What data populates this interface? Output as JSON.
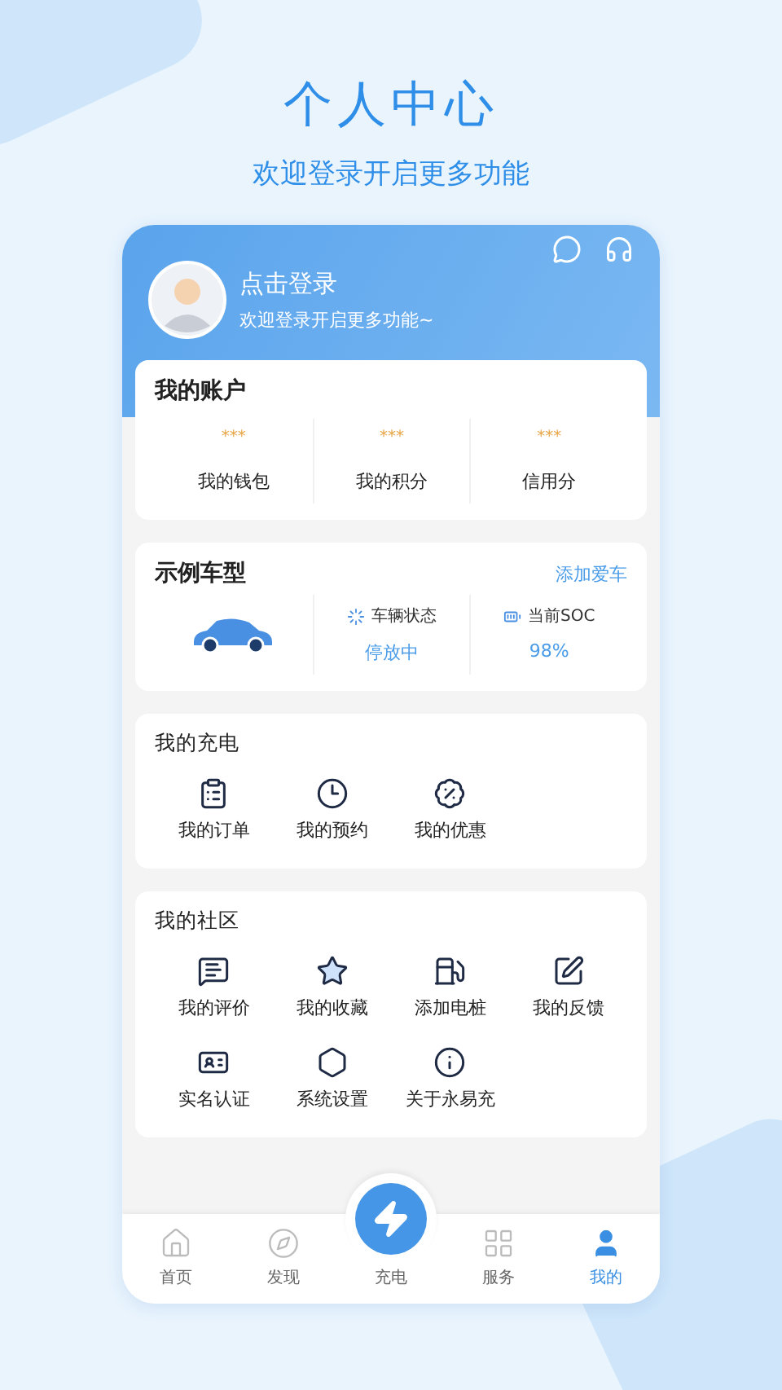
{
  "header": {
    "title": "个人中心",
    "subtitle": "欢迎登录开启更多功能"
  },
  "profile": {
    "name": "点击登录",
    "tagline": "欢迎登录开启更多功能~"
  },
  "account": {
    "title": "我的账户",
    "items": [
      {
        "value": "***",
        "label": "我的钱包"
      },
      {
        "value": "***",
        "label": "我的积分"
      },
      {
        "value": "***",
        "label": "信用分"
      }
    ]
  },
  "vehicle": {
    "title": "示例车型",
    "action": "添加爱车",
    "stats": [
      {
        "kind": "status",
        "label": "车辆状态",
        "value": "停放中"
      },
      {
        "kind": "soc",
        "label": "当前SOC",
        "value": "98%"
      }
    ]
  },
  "charging": {
    "title": "我的充电",
    "items": [
      {
        "kind": "order",
        "label": "我的订单"
      },
      {
        "kind": "booking",
        "label": "我的预约"
      },
      {
        "kind": "coupon",
        "label": "我的优惠"
      }
    ]
  },
  "community": {
    "title": "我的社区",
    "items": [
      {
        "kind": "review",
        "label": "我的评价"
      },
      {
        "kind": "favorite",
        "label": "我的收藏"
      },
      {
        "kind": "charger",
        "label": "添加电桩"
      },
      {
        "kind": "feedback",
        "label": "我的反馈"
      },
      {
        "kind": "verify",
        "label": "实名认证"
      },
      {
        "kind": "settings",
        "label": "系统设置"
      },
      {
        "kind": "about",
        "label": "关于永易充"
      }
    ]
  },
  "nav": [
    {
      "kind": "home",
      "label": "首页",
      "selected": false
    },
    {
      "kind": "discover",
      "label": "发现",
      "selected": false
    },
    {
      "kind": "charge",
      "label": "充电",
      "selected": false
    },
    {
      "kind": "service",
      "label": "服务",
      "selected": false
    },
    {
      "kind": "mine",
      "label": "我的",
      "selected": true
    }
  ]
}
